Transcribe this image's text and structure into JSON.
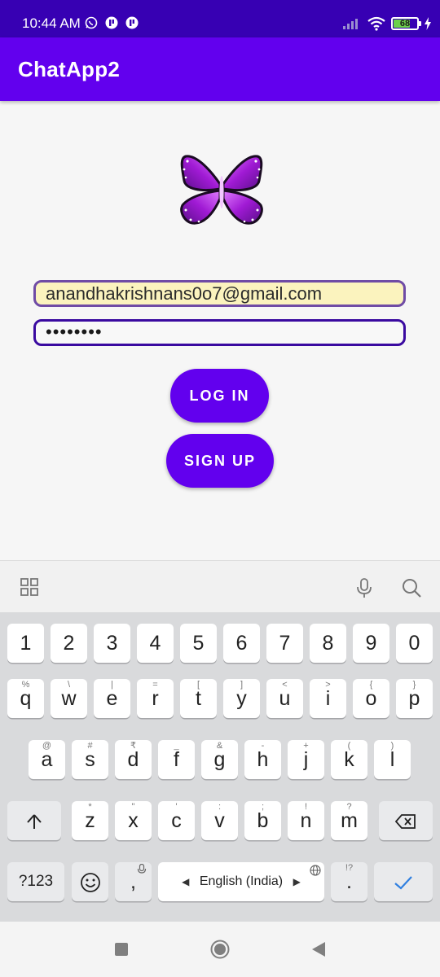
{
  "status_bar": {
    "time": "10:44 AM",
    "battery": "68",
    "notification_icons": [
      "whatsapp-icon",
      "app-notification-icon",
      "app-notification-icon"
    ],
    "indicators": [
      "signal-icon",
      "wifi-icon",
      "battery-icon",
      "charging-icon"
    ]
  },
  "app_bar": {
    "title": "ChatApp2"
  },
  "login_form": {
    "logo": "butterfly-logo",
    "email_value": "anandhakrishnans0o7@gmail.com",
    "password_value": "••••••••",
    "login_label": "LOG IN",
    "signup_label": "SIGN UP",
    "accent_color": "#6200ee",
    "email_field_bg": "#fbf3be"
  },
  "keyboard": {
    "toolbar": {
      "left_icon": "grid-apps-icon",
      "right_icons": [
        "microphone-icon",
        "search-icon"
      ]
    },
    "number_row": [
      "1",
      "2",
      "3",
      "4",
      "5",
      "6",
      "7",
      "8",
      "9",
      "0"
    ],
    "row1": [
      {
        "key": "q",
        "sub": "%"
      },
      {
        "key": "w",
        "sub": "\\"
      },
      {
        "key": "e",
        "sub": "|"
      },
      {
        "key": "r",
        "sub": "="
      },
      {
        "key": "t",
        "sub": "["
      },
      {
        "key": "y",
        "sub": "]"
      },
      {
        "key": "u",
        "sub": "<"
      },
      {
        "key": "i",
        "sub": ">"
      },
      {
        "key": "o",
        "sub": "{"
      },
      {
        "key": "p",
        "sub": "}"
      }
    ],
    "row2": [
      {
        "key": "a",
        "sub": "@"
      },
      {
        "key": "s",
        "sub": "#"
      },
      {
        "key": "d",
        "sub": "₹"
      },
      {
        "key": "f",
        "sub": "_"
      },
      {
        "key": "g",
        "sub": "&"
      },
      {
        "key": "h",
        "sub": "-"
      },
      {
        "key": "j",
        "sub": "+"
      },
      {
        "key": "k",
        "sub": "("
      },
      {
        "key": "l",
        "sub": ")"
      }
    ],
    "row3": [
      {
        "key": "z",
        "sub": "*"
      },
      {
        "key": "x",
        "sub": "\""
      },
      {
        "key": "c",
        "sub": "'"
      },
      {
        "key": "v",
        "sub": ":"
      },
      {
        "key": "b",
        "sub": ";"
      },
      {
        "key": "n",
        "sub": "!"
      },
      {
        "key": "m",
        "sub": "?"
      }
    ],
    "bottom_row": {
      "symbols_label": "?123",
      "comma_label": ",",
      "space_label": "English (India)",
      "period_label": ".",
      "period_sub": "!?"
    }
  },
  "nav_bar": {
    "buttons": [
      "recents-square-icon",
      "home-circle-icon",
      "back-triangle-icon"
    ]
  }
}
